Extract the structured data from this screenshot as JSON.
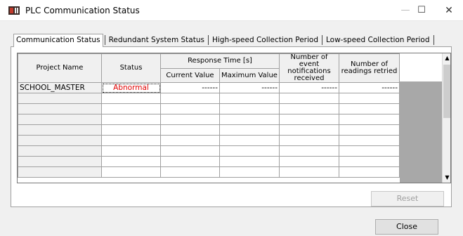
{
  "window": {
    "title": "PLC Communication Status",
    "min_glyph": "—",
    "max_glyph": "☐",
    "close_glyph": "✕"
  },
  "tabs": [
    {
      "label": "Communication Status",
      "active": true
    },
    {
      "label": "Redundant System Status",
      "active": false
    },
    {
      "label": "High-speed Collection Period",
      "active": false
    },
    {
      "label": "Low-speed Collection Period",
      "active": false
    }
  ],
  "grid": {
    "headers": {
      "project_name": "Project Name",
      "status": "Status",
      "response_time": "Response Time [s]",
      "current_value": "Current Value",
      "maximum_value": "Maximum Value",
      "event_notifications": "Number of event notifications received",
      "readings_retried": "Number of readings retried"
    },
    "rows": [
      {
        "project_name": "SCHOOL_MASTER",
        "status": "Abnormal",
        "current_value": "------",
        "maximum_value": "------",
        "event_notifications": "------",
        "readings_retried": "------"
      }
    ],
    "status_color": "#e00000"
  },
  "buttons": {
    "reset": "Reset",
    "close": "Close"
  },
  "icons": {
    "app": "plc-app-icon",
    "scroll_up": "▲",
    "scroll_down": "▼"
  }
}
